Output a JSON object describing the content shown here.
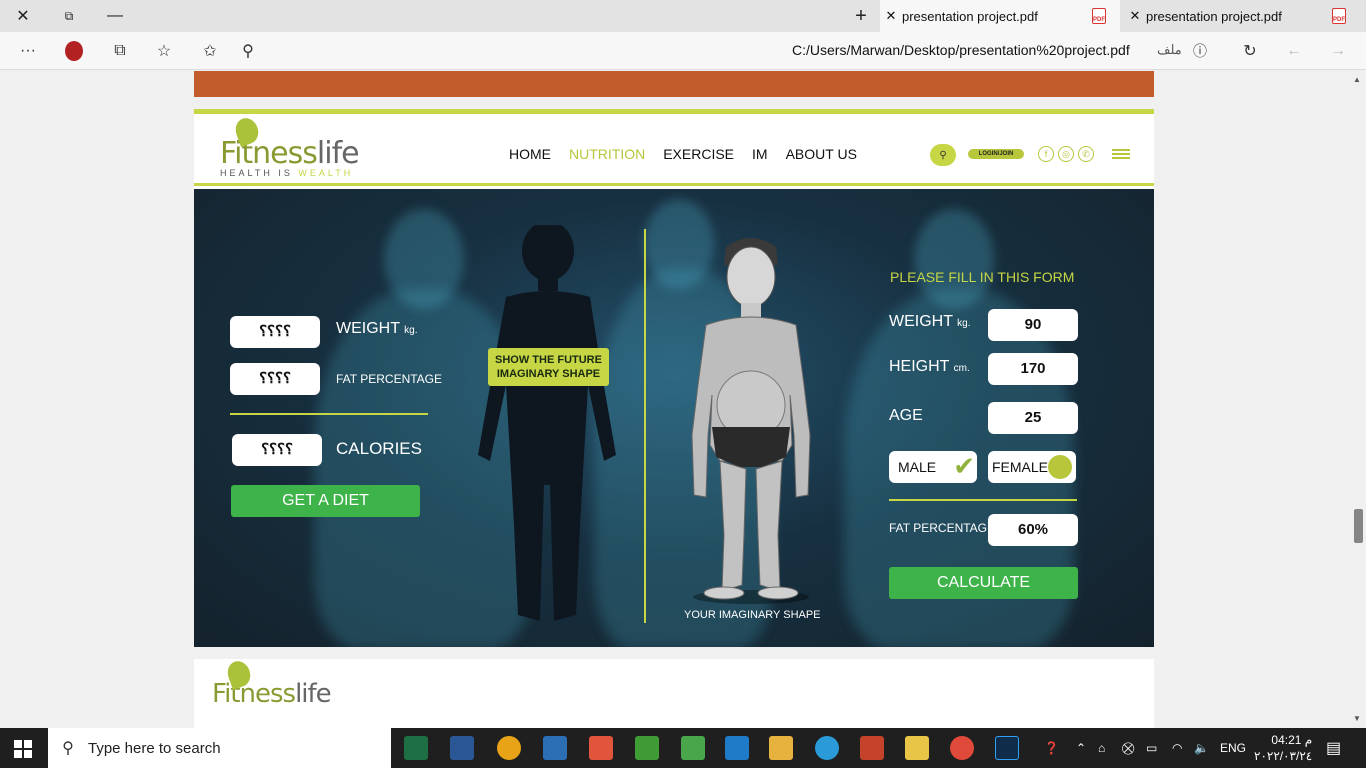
{
  "browser": {
    "tabs": [
      {
        "title": "presentation project.pdf",
        "active": true
      },
      {
        "title": "presentation project.pdf",
        "active": false
      }
    ],
    "address": "C:/Users/Marwan/Desktop/presentation%20project.pdf",
    "file_label": "ملف"
  },
  "site": {
    "logo_main": "Fitness",
    "logo_second": "life",
    "logo_tag_a": "HEALTH IS ",
    "logo_tag_b": "WEALTH",
    "menu": [
      "HOME",
      "NUTRITION",
      "EXERCISE",
      "IM",
      "ABOUT US"
    ],
    "active_menu": "NUTRITION",
    "login": "LOGIN/JOIN",
    "accent": "#c6d645"
  },
  "left_panel": {
    "weight_value": "؟؟؟؟",
    "weight_label": "WEIGHT",
    "weight_unit": "kg.",
    "fat_value": "؟؟؟؟",
    "fat_label": "FAT PERCENTAGE",
    "calories_value": "؟؟؟؟",
    "calories_label": "CALORIES",
    "diet_button": "GET A DIET"
  },
  "center": {
    "future_button_line1": "SHOW THE FUTURE",
    "future_button_line2": "IMAGINARY SHAPE",
    "caption": "YOUR IMAGINARY SHAPE"
  },
  "form": {
    "title": "PLEASE FILL IN THIS FORM",
    "weight_label": "WEIGHT",
    "weight_unit": "kg.",
    "weight_value": "90",
    "height_label": "HEIGHT",
    "height_unit": "cm.",
    "height_value": "170",
    "age_label": "AGE",
    "age_value": "25",
    "male_label": "MALE",
    "female_label": "FEMALE",
    "fat_label": "FAT PERCENTAGE",
    "fat_value": "60%",
    "calculate_button": "CALCULATE"
  },
  "taskbar": {
    "search_placeholder": "Type here to search",
    "lang": "ENG",
    "time": "04:21 م",
    "date": "٢٠٢٢/٠٣/٢٤"
  }
}
